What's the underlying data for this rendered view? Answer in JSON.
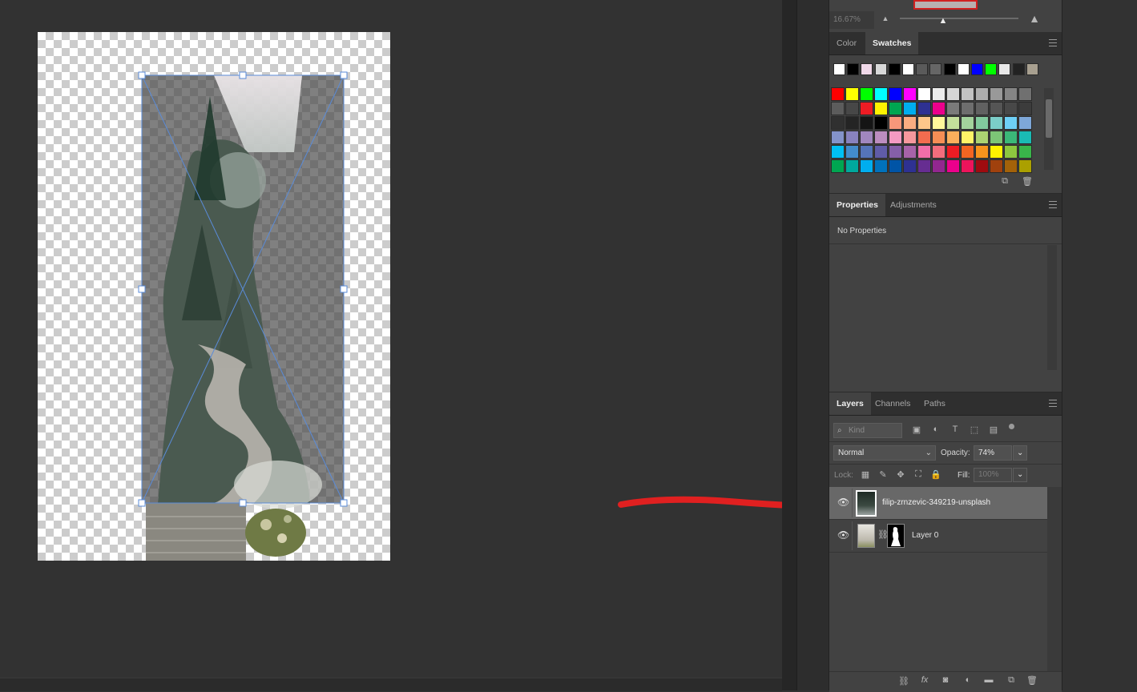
{
  "navigator": {
    "zoom": "16.67%"
  },
  "color_panel": {
    "tabs": [
      {
        "label": "Color"
      },
      {
        "label": "Swatches"
      }
    ],
    "active_tab": "Swatches",
    "recent_swatches": [
      "#ffffff",
      "#000000",
      "#f0d8e8",
      "#d8d8d8",
      "#000000",
      "#ffffff",
      "#5a5a5a",
      "#666666",
      "#000000",
      "#ffffff",
      "#0000ff",
      "#00ff00",
      "#e8e8e8",
      "#222222",
      "#a8a090"
    ],
    "swatches": [
      [
        "#ff0000",
        "#ffff00",
        "#00ff00",
        "#00ffff",
        "#0000ff",
        "#ff00ff",
        "#ffffff",
        "#ebebeb",
        "#d6d6d6",
        "#c2c2c2",
        "#adadad",
        "#999999",
        "#858585",
        "#707070"
      ],
      [
        "#5c5c5c",
        "#474747",
        "#ed1c24",
        "#fff200",
        "#00a651",
        "#00aeef",
        "#2e3192",
        "#ec008c",
        "#7a7a7a",
        "#6e6e6e",
        "#616161",
        "#555555",
        "#484848",
        "#3c3c3c"
      ],
      [
        "#303030",
        "#242424",
        "#151515",
        "#000000",
        "#f7977a",
        "#f9ad81",
        "#fdc68a",
        "#fff79a",
        "#c4df9b",
        "#a3d39c",
        "#82ca9d",
        "#7bcdc8",
        "#6ecff6",
        "#7ea7d8"
      ],
      [
        "#8493ca",
        "#8882be",
        "#a187be",
        "#bc8dbf",
        "#f49ac2",
        "#f6989d",
        "#f26c4f",
        "#f68e55",
        "#fbaf5c",
        "#fff467",
        "#acd372",
        "#7cc576",
        "#3bb878",
        "#1abbb4"
      ],
      [
        "#00bff3",
        "#438ccb",
        "#5574b9",
        "#605ca8",
        "#855fa8",
        "#a763a8",
        "#f06ea9",
        "#f26d7d",
        "#ed1c24",
        "#f26522",
        "#f7941d",
        "#fff200",
        "#8dc73f",
        "#39b54a"
      ],
      [
        "#00a651",
        "#00a99d",
        "#00aeef",
        "#0072bc",
        "#0054a6",
        "#2e3192",
        "#662d91",
        "#92278f",
        "#ec008c",
        "#ed145b",
        "#9e0b0f",
        "#a0410d",
        "#a36209",
        "#aba000"
      ]
    ]
  },
  "properties_panel": {
    "tabs": [
      {
        "label": "Properties"
      },
      {
        "label": "Adjustments"
      }
    ],
    "active_tab": "Properties",
    "message": "No Properties"
  },
  "layers_panel": {
    "tabs": [
      {
        "label": "Layers"
      },
      {
        "label": "Channels"
      },
      {
        "label": "Paths"
      }
    ],
    "active_tab": "Layers",
    "filter_placeholder": "Kind",
    "blend_mode": "Normal",
    "opacity_label": "Opacity:",
    "opacity_value": "74%",
    "lock_label": "Lock:",
    "fill_label": "Fill:",
    "fill_value": "100%",
    "layers": [
      {
        "name": "filip-zrnzevic-349219-unsplash",
        "selected": true,
        "visible": true,
        "has_mask": false
      },
      {
        "name": "Layer 0",
        "selected": false,
        "visible": true,
        "has_mask": true
      }
    ]
  },
  "colors": {
    "accent_arrow": "#e02020",
    "transform_box": "#5a8bd8"
  }
}
